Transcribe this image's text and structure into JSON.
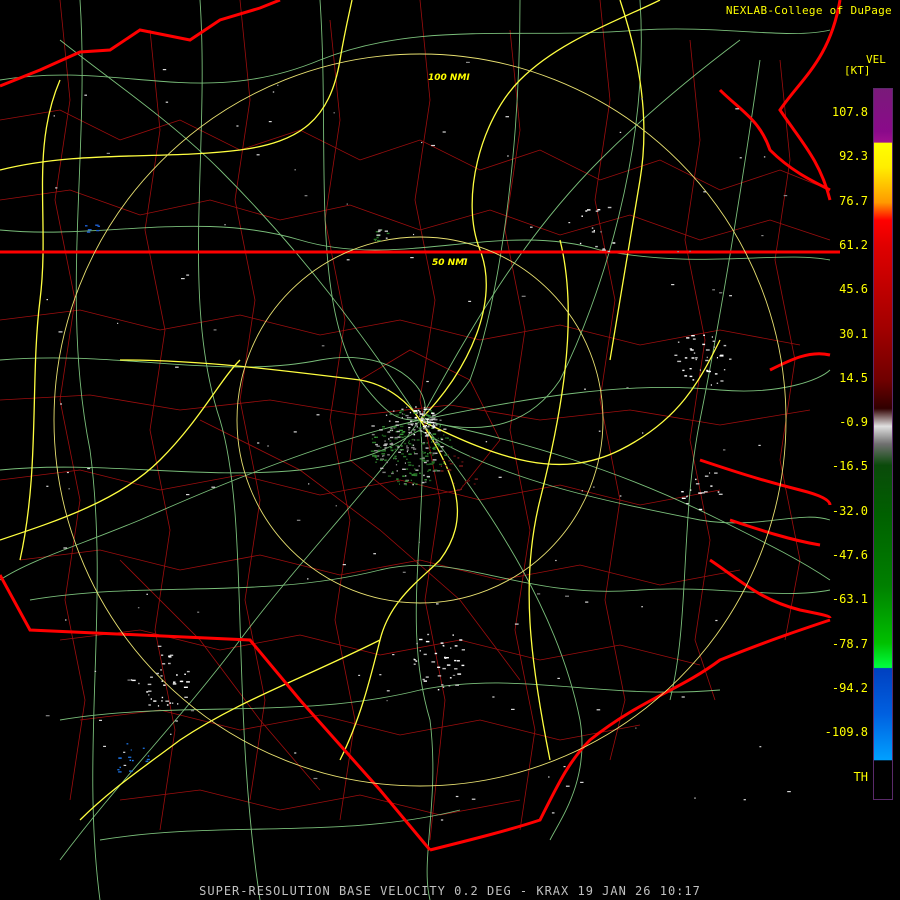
{
  "credit": "NEXLAB-College of DuPage",
  "colorbar": {
    "title": "VEL",
    "unit": "[KT]",
    "ticks": [
      "107.8",
      "92.3",
      "76.7",
      "61.2",
      "45.6",
      "30.1",
      "14.5",
      "-0.9",
      "-16.5",
      "-32.0",
      "-47.6",
      "-63.1",
      "-78.7",
      "-94.2",
      "-109.8",
      "TH"
    ]
  },
  "range_rings": {
    "inner": "50 NMI",
    "outer": "100 NMI"
  },
  "footer": "SUPER-RESOLUTION BASE VELOCITY 0.2 DEG - KRAX 19 JAN 26 10:17",
  "colors": {
    "state_border": "#ff0000",
    "county_border": "#b01010",
    "highway_major": "#ffff40",
    "highway_minor": "#90e090",
    "range_ring": "#e8e070",
    "label": "#ffff00"
  }
}
